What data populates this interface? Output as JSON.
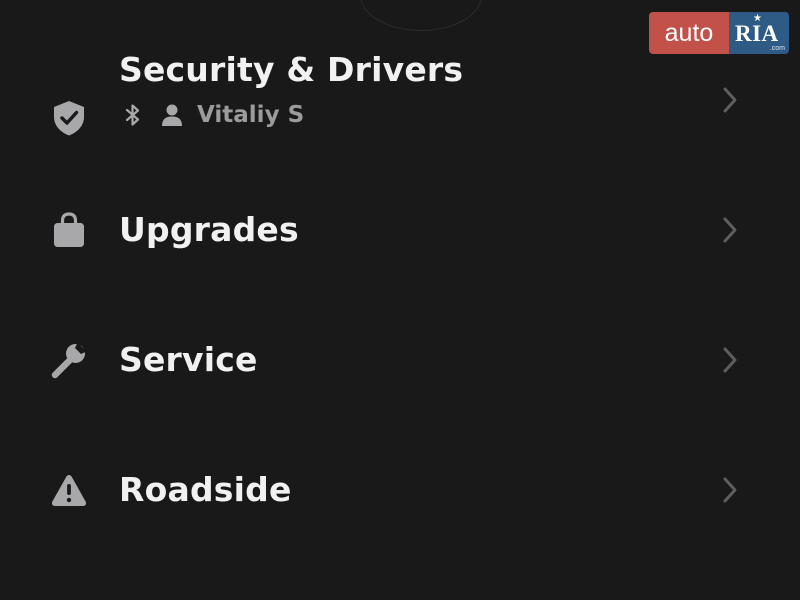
{
  "colors": {
    "background": "#19191a",
    "title_text": "#f1f1f1",
    "icon": "#a8a8aa",
    "subtitle": "#9b9b9d",
    "chevron": "#5e5e60"
  },
  "menu": {
    "items": [
      {
        "label": "Security & Drivers",
        "icon": "shield-check-icon"
      },
      {
        "label": "Upgrades",
        "icon": "shopping-bag-icon"
      },
      {
        "label": "Service",
        "icon": "wrench-icon"
      },
      {
        "label": "Roadside",
        "icon": "warning-triangle-icon"
      }
    ]
  },
  "security": {
    "driver_name": "Vitaliy S",
    "icons": [
      "bluetooth-icon",
      "person-icon"
    ]
  },
  "watermark": {
    "left_text": "auto",
    "right_text": "RIA",
    "domain_text": ".com",
    "colors": {
      "left": "#c2514a",
      "right": "#2e5b86"
    }
  }
}
